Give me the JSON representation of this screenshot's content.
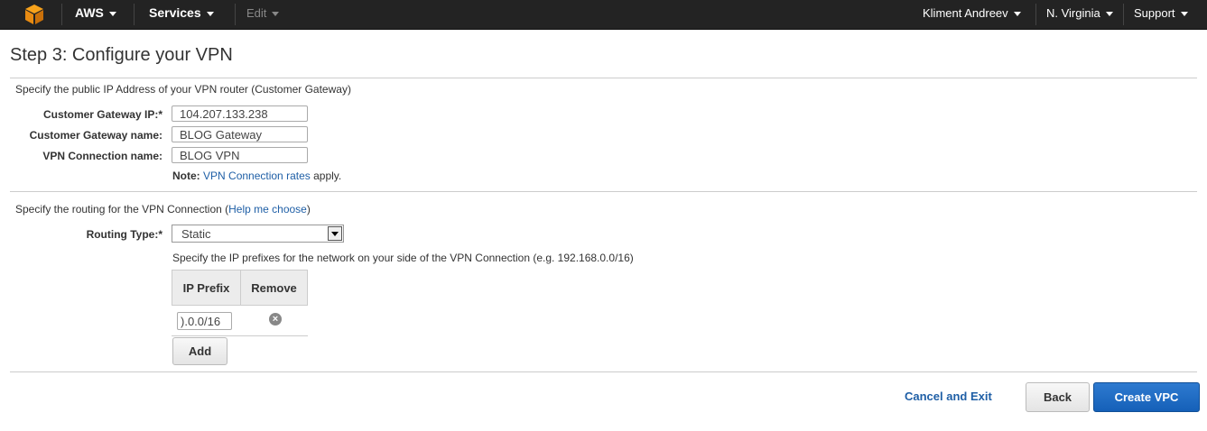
{
  "nav": {
    "brand": "AWS",
    "services": "Services",
    "edit": "Edit",
    "user": "Kliment Andreev",
    "region": "N. Virginia",
    "support": "Support"
  },
  "page": {
    "title": "Step 3: Configure your VPN"
  },
  "gateway_section": {
    "description": "Specify the public IP Address of your VPN router (Customer Gateway)",
    "ip_label": "Customer Gateway IP:*",
    "ip_value": "104.207.133.238",
    "name_label": "Customer Gateway name:",
    "name_value": "BLOG Gateway",
    "vpn_label": "VPN Connection name:",
    "vpn_value": "BLOG VPN",
    "note_prefix": "Note:",
    "note_link": "VPN Connection rates",
    "note_suffix": "apply."
  },
  "routing_section": {
    "description_prefix": "Specify the routing for the VPN Connection (",
    "help_link": "Help me choose",
    "description_suffix": ")",
    "type_label": "Routing Type:*",
    "type_value": "Static",
    "prefix_hint": "Specify the IP prefixes for the network on your side of the VPN Connection (e.g. 192.168.0.0/16)",
    "table_headers": [
      "IP Prefix",
      "Remove"
    ],
    "prefix_value": ").0.0/16",
    "add_label": "Add"
  },
  "footer": {
    "cancel_label": "Cancel and Exit",
    "back_label": "Back",
    "create_label": "Create VPC"
  },
  "colors": {
    "accent": "#1f5fa6",
    "primary_button": "#1a68c4",
    "topbar": "#232323"
  }
}
